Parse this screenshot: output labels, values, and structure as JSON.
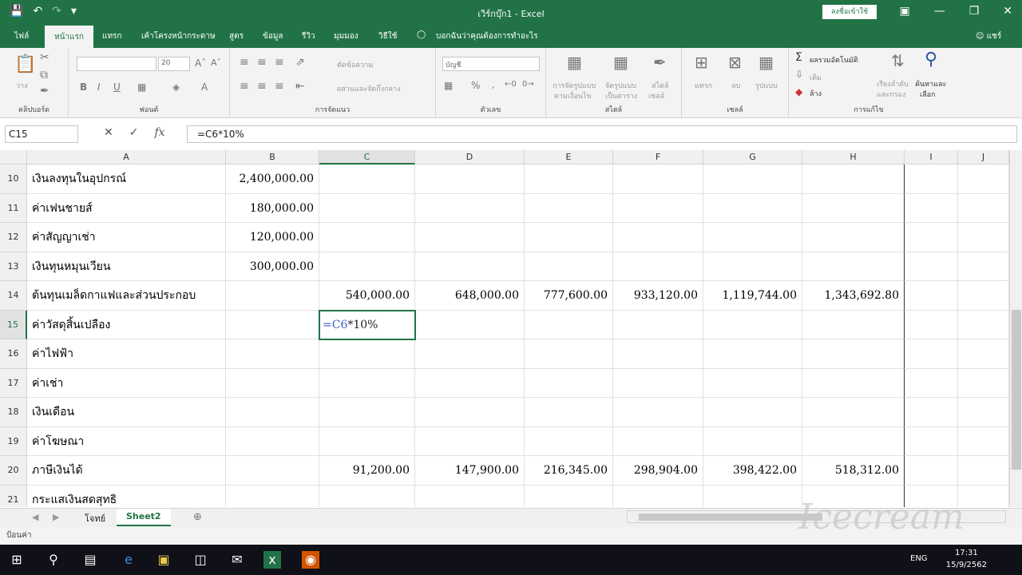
{
  "app": {
    "title": "เวิร์กบุ๊ก1 - Excel",
    "signin": "ลงชื่อเข้าใช้",
    "share": "แชร์",
    "tell_me": "บอกฉันว่าคุณต้องการทำอะไร"
  },
  "tabs": [
    "ไฟล์",
    "หน้าแรก",
    "แทรก",
    "เค้าโครงหน้ากระดาษ",
    "สูตร",
    "ข้อมูล",
    "รีวิว",
    "มุมมอง",
    "วิธีใช้"
  ],
  "ribbon": {
    "groups": [
      "คลิปบอร์ด",
      "ฟอนต์",
      "การจัดแนว",
      "ตัวเลข",
      "สไตล์",
      "เซลล์",
      "การแก้ไข"
    ],
    "paste": "วาง",
    "font_size": "20",
    "wrap": "ตัดข้อความ",
    "merge": "ผสานและจัดกึ่งกลาง",
    "number_format": "บัญชี",
    "conditional": [
      "การจัดรูปแบบ",
      "ตามเงื่อนไข"
    ],
    "format_table": [
      "จัดรูปแบบ",
      "เป็นตาราง"
    ],
    "cell_styles": [
      "สไตล์",
      "เซลล์"
    ],
    "insert": "แทรก",
    "delete": "ลบ",
    "format": "รูปแบบ",
    "autosum": "ผลรวมอัตโนมัติ",
    "fill": "เติม",
    "clear": "ล้าง",
    "sort": [
      "เรียงลำดับ",
      "และกรอง"
    ],
    "find": [
      "ค้นหาและ",
      "เลือก"
    ]
  },
  "formula_bar": {
    "name_box": "C15",
    "formula": "=C6*10%"
  },
  "columns": [
    "A",
    "B",
    "C",
    "D",
    "E",
    "F",
    "G",
    "H",
    "I",
    "J"
  ],
  "rows": [
    {
      "num": "10",
      "a": "เงินลงทุนในอุปกรณ์",
      "b": "2,400,000.00",
      "c": "",
      "d": "",
      "e": "",
      "f": "",
      "g": "",
      "h": ""
    },
    {
      "num": "11",
      "a": "ค่าเฟนชายส์",
      "b": "180,000.00",
      "c": "",
      "d": "",
      "e": "",
      "f": "",
      "g": "",
      "h": ""
    },
    {
      "num": "12",
      "a": "ค่าสัญญาเช่า",
      "b": "120,000.00",
      "c": "",
      "d": "",
      "e": "",
      "f": "",
      "g": "",
      "h": ""
    },
    {
      "num": "13",
      "a": "เงินทุนหมุนเวียน",
      "b": "300,000.00",
      "c": "",
      "d": "",
      "e": "",
      "f": "",
      "g": "",
      "h": ""
    },
    {
      "num": "14",
      "a": "ต้นทุนเมล็ดกาแฟและส่วนประกอบ",
      "b": "",
      "c": "540,000.00",
      "d": "648,000.00",
      "e": "777,600.00",
      "f": "933,120.00",
      "g": "1,119,744.00",
      "h": "1,343,692.80"
    },
    {
      "num": "15",
      "a": "ค่าวัสดุสิ้นเปลือง",
      "b": "",
      "c": "",
      "d": "",
      "e": "",
      "f": "",
      "g": "",
      "h": ""
    },
    {
      "num": "16",
      "a": "ค่าไฟฟ้า",
      "b": "",
      "c": "",
      "d": "",
      "e": "",
      "f": "",
      "g": "",
      "h": ""
    },
    {
      "num": "17",
      "a": "ค่าเช่า",
      "b": "",
      "c": "",
      "d": "",
      "e": "",
      "f": "",
      "g": "",
      "h": ""
    },
    {
      "num": "18",
      "a": "เงินเดือน",
      "b": "",
      "c": "",
      "d": "",
      "e": "",
      "f": "",
      "g": "",
      "h": ""
    },
    {
      "num": "19",
      "a": "ค่าโฆษณา",
      "b": "",
      "c": "",
      "d": "",
      "e": "",
      "f": "",
      "g": "",
      "h": ""
    },
    {
      "num": "20",
      "a": "ภาษีเงินได้",
      "b": "",
      "c": "91,200.00",
      "d": "147,900.00",
      "e": "216,345.00",
      "f": "298,904.00",
      "g": "398,422.00",
      "h": "518,312.00"
    },
    {
      "num": "21",
      "a": "กระแสเงินสดสุทธิ",
      "b": "",
      "c": "",
      "d": "",
      "e": "",
      "f": "",
      "g": "",
      "h": ""
    }
  ],
  "active_cell": {
    "ref": "=C6",
    "rest": "*10%"
  },
  "sheets": [
    "โจทย์",
    "Sheet2"
  ],
  "status": "ป้อนค่า",
  "taskbar": {
    "lang": "ENG",
    "time": "17:31",
    "date": "15/9/2562"
  },
  "colors": {
    "excel_green": "#217346",
    "ref_blue": "#3b62c4"
  }
}
